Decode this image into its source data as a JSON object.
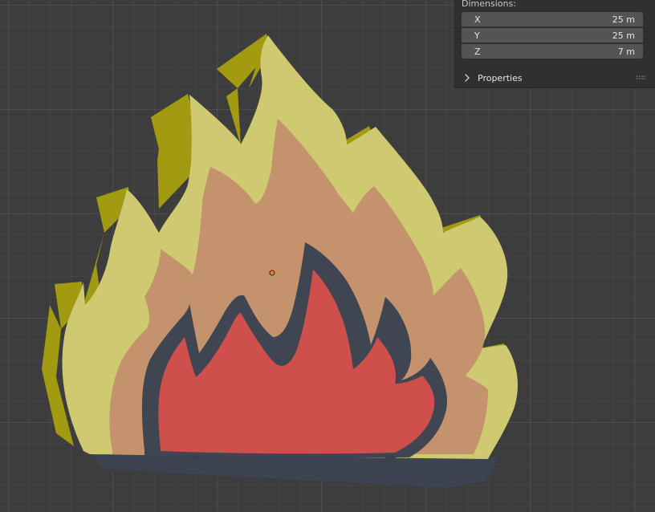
{
  "panel": {
    "section_title": "Dimensions:",
    "dimensions": [
      {
        "axis": "X",
        "value": "25 m"
      },
      {
        "axis": "Y",
        "value": "25 m"
      },
      {
        "axis": "Z",
        "value": "7 m"
      }
    ],
    "properties_label": "Properties"
  },
  "scene": {
    "object": "flame",
    "colors": {
      "background": "#3d3d3d",
      "outer_front": "#cfca72",
      "outer_side": "#a29a10",
      "middle": "#c4936d",
      "inner_outline": "#404552",
      "inner_fill": "#cf4f4c",
      "base": "#3a3f4b",
      "origin": "#f08020"
    }
  },
  "icons": {
    "chevron": "chevron-right-icon",
    "grip": "drag-grip-icon",
    "origin": "object-origin-icon"
  }
}
